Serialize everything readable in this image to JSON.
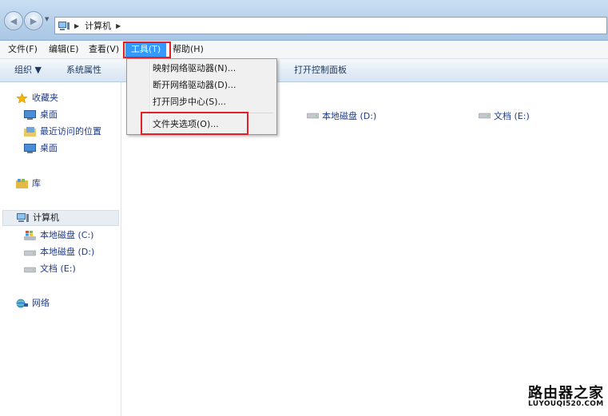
{
  "address": {
    "path": "计算机"
  },
  "menubar": {
    "file": "文件(F)",
    "edit": "编辑(E)",
    "view": "查看(V)",
    "tools": "工具(T)",
    "help": "帮助(H)"
  },
  "toolbar": {
    "organize": "组织 ▼",
    "system_properties": "系统属性",
    "open_control_panel": "打开控制面板"
  },
  "tools_menu": {
    "items": [
      "映射网络驱动器(N)...",
      "断开网络驱动器(D)...",
      "打开同步中心(S)...",
      "文件夹选项(O)..."
    ]
  },
  "nav": {
    "favorites": "收藏夹",
    "desktop1": "桌面",
    "recent_places": "最近访问的位置",
    "desktop2": "桌面",
    "libraries": "库",
    "computer": "计算机",
    "drive_c": "本地磁盘 (C:)",
    "drive_d": "本地磁盘 (D:)",
    "drive_e": "文档 (E:)",
    "network": "网络"
  },
  "content": {
    "drive_d": "本地磁盘 (D:)",
    "drive_e": "文档 (E:)"
  },
  "watermark": {
    "title": "路由器之家",
    "url": "LUYOUQI520.COM"
  },
  "colors": {
    "menu_highlight": "#3399ff",
    "annotation_red": "#e51f26",
    "link_blue": "#1e3a8a"
  }
}
